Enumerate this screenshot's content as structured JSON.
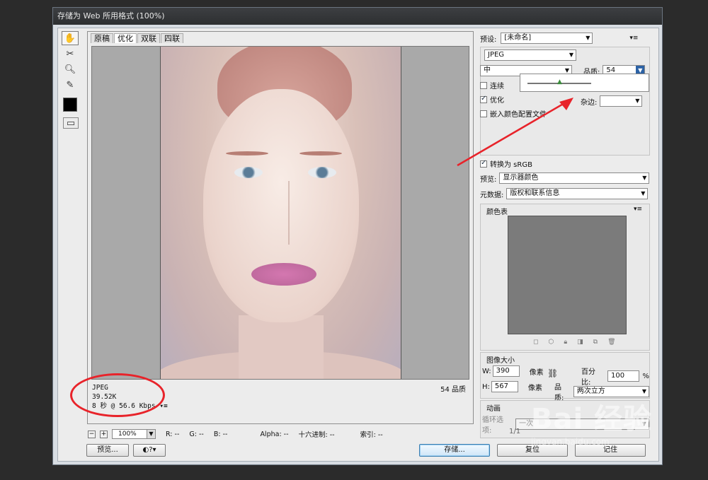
{
  "window": {
    "title": "存储为 Web 所用格式 (100%)"
  },
  "tools": [
    "hand-tool",
    "slice-select-tool",
    "zoom-tool",
    "eyedropper-tool"
  ],
  "tabs": [
    "原稿",
    "优化",
    "双联",
    "四联"
  ],
  "preview_info": {
    "format": "JPEG",
    "size": "39.52K",
    "time": "8 秒 @ 56.6 Kbps",
    "quality": "54 品质"
  },
  "statusbar": {
    "zoom": "100%",
    "r": "R: --",
    "g": "G: --",
    "b": "B: --",
    "alpha": "Alpha: --",
    "hex": "十六进制: --",
    "index": "索引: --"
  },
  "buttons": {
    "preview": "预览...",
    "save": "存储...",
    "reset": "复位",
    "remember": "记住"
  },
  "settings": {
    "preset_label": "预设:",
    "preset_value": "[未命名]",
    "format": "JPEG",
    "compression": "中",
    "quality_label": "品质:",
    "quality_value": "54",
    "progressive": "连续",
    "optimized": "优化",
    "embed_profile": "嵌入颜色配置文件",
    "matte_label": "杂边:",
    "convert_srgb": "转换为 sRGB",
    "preview_label": "预览:",
    "preview_value": "显示器颜色",
    "metadata_label": "元数据:",
    "metadata_value": "版权和联系信息"
  },
  "color_table": {
    "title": "颜色表"
  },
  "image_size": {
    "title": "图像大小",
    "w_label": "W:",
    "w_value": "390",
    "h_label": "H:",
    "h_value": "567",
    "unit": "像素",
    "percent_label": "百分比:",
    "percent_value": "100",
    "percent_unit": "%",
    "quality_label": "品质:",
    "quality_value": "两次立方"
  },
  "animation": {
    "title": "动画",
    "loop_label": "循环选项:",
    "loop_value": "一次",
    "frame": "1/1"
  },
  "watermark": {
    "brand": "Bai 经验",
    "url": "jingyan.baidu.com"
  },
  "colors": {
    "annotation": "#e8232a",
    "accent": "#3c7fb1"
  }
}
